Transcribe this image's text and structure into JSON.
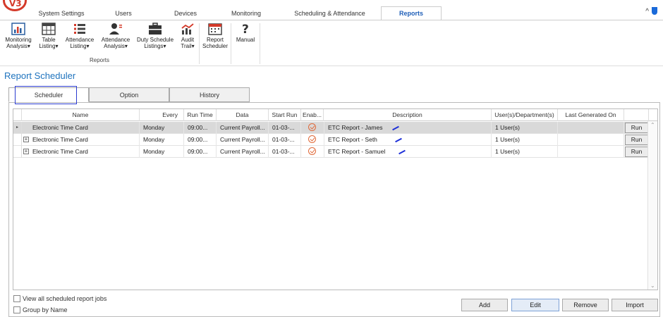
{
  "app": {
    "logo": "V3"
  },
  "top_tabs": [
    {
      "label": "System Settings",
      "active": false
    },
    {
      "label": "Users",
      "active": false
    },
    {
      "label": "Devices",
      "active": false
    },
    {
      "label": "Monitoring",
      "active": false
    },
    {
      "label": "Scheduling & Attendance",
      "active": false
    },
    {
      "label": "Reports",
      "active": true
    }
  ],
  "top_right": {
    "collapse_glyph": "^"
  },
  "ribbon": {
    "buttons": [
      {
        "label1": "Monitoring",
        "label2": "Analysis▾",
        "icon": "bar-chart-icon"
      },
      {
        "label1": "Table",
        "label2": "Listing▾",
        "icon": "table-icon"
      },
      {
        "label1": "Attendance",
        "label2": "Listing▾",
        "icon": "list-icon"
      },
      {
        "label1": "Attendance",
        "label2": "Analysis▾",
        "icon": "user-chart-icon"
      },
      {
        "label1": "Duty Schedule",
        "label2": "Listings▾",
        "icon": "briefcase-icon"
      },
      {
        "label1": "Audit",
        "label2": "Trail▾",
        "icon": "trend-icon"
      },
      {
        "label1": "Report",
        "label2": "Scheduler",
        "icon": "calendar-icon"
      },
      {
        "label1": "Manual",
        "label2": "",
        "icon": "help-icon"
      }
    ],
    "group_label": "Reports"
  },
  "page_title": "Report Scheduler",
  "sub_tabs": [
    {
      "label": "Scheduler",
      "active": true
    },
    {
      "label": "Option",
      "active": false
    },
    {
      "label": "History",
      "active": false
    }
  ],
  "grid": {
    "columns": [
      "Name",
      "Every",
      "Run Time",
      "Data",
      "Start Run",
      "Enab...",
      "Description",
      "User(s)/Department(s)",
      "Last Generated On"
    ],
    "rows": [
      {
        "indicator": "▸",
        "expand": "",
        "name": "Electronic Time Card",
        "every": "Monday",
        "run_time": "09:00...",
        "data": "Current Payroll...",
        "start_run": "01-03-...",
        "description": "ETC Report - James",
        "users": "1 User(s)",
        "last_generated": "",
        "run": "Run",
        "selected": true
      },
      {
        "indicator": "",
        "expand": "+",
        "name": "Electronic Time Card",
        "every": "Monday",
        "run_time": "09:00...",
        "data": "Current Payroll...",
        "start_run": "01-03-...",
        "description": "ETC Report - Seth",
        "users": "1 User(s)",
        "last_generated": "",
        "run": "Run",
        "selected": false
      },
      {
        "indicator": "",
        "expand": "+",
        "name": "Electronic Time Card",
        "every": "Monday",
        "run_time": "09:00...",
        "data": "Current Payroll...",
        "start_run": "01-03-...",
        "description": "ETC Report - Samuel",
        "users": "1 User(s)",
        "last_generated": "",
        "run": "Run",
        "selected": false
      }
    ]
  },
  "options": {
    "view_all_label": "View all scheduled report jobs",
    "group_by_label": "Group by Name"
  },
  "actions": {
    "add": "Add",
    "edit": "Edit",
    "remove": "Remove",
    "import": "Import"
  },
  "colors": {
    "accent": "#1e73be",
    "focus_border": "#2a3bd0",
    "logo_red": "#d43a2a",
    "enabled_check": "#e06a3a"
  }
}
